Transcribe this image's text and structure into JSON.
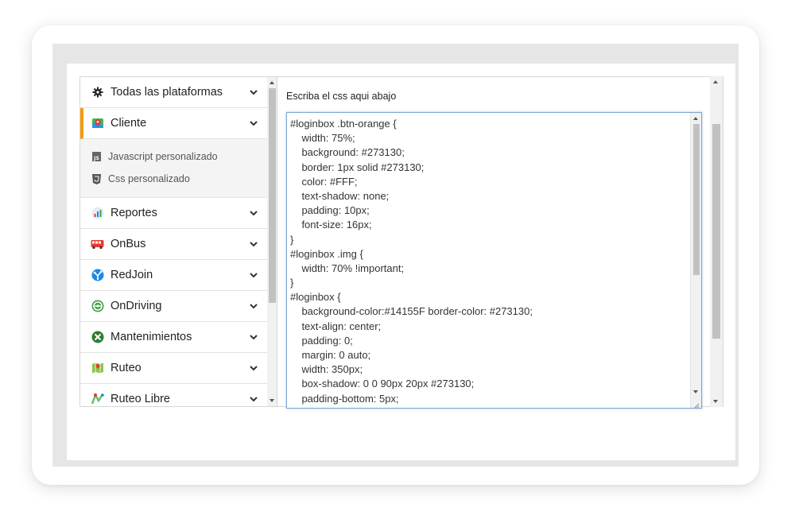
{
  "sidebar": {
    "items": [
      {
        "label": "Todas las plataformas",
        "icon": "gear-icon"
      },
      {
        "label": "Cliente",
        "icon": "map-pin-icon",
        "active": true
      },
      {
        "label": "Reportes",
        "icon": "bar-chart-icon"
      },
      {
        "label": "OnBus",
        "icon": "bus-icon"
      },
      {
        "label": "RedJoin",
        "icon": "network-icon"
      },
      {
        "label": "OnDriving",
        "icon": "steering-wheel-icon"
      },
      {
        "label": "Mantenimientos",
        "icon": "wrench-icon"
      },
      {
        "label": "Ruteo",
        "icon": "map-icon"
      },
      {
        "label": "Ruteo Libre",
        "icon": "route-icon"
      }
    ],
    "submenu": [
      {
        "label": "Javascript personalizado",
        "icon": "js-file-icon"
      },
      {
        "label": "Css personalizado",
        "icon": "css3-icon"
      }
    ]
  },
  "main": {
    "label": "Escriba el css aqui abajo",
    "code_lines": [
      "#loginbox .btn-orange {",
      "    width: 75%;",
      "    background: #273130;",
      "    border: 1px solid #273130;",
      "    color: #FFF;",
      "    text-shadow: none;",
      "    padding: 10px;",
      "    font-size: 16px;",
      "}",
      "#loginbox .img {",
      "    width: 70% !important;",
      "}",
      "#loginbox {",
      "    background-color:#14155F border-color: #273130;",
      "    text-align: center;",
      "    padding: 0;",
      "    margin: 0 auto;",
      "    width: 350px;",
      "    box-shadow: 0 0 90px 20px #273130;",
      "    padding-bottom: 5px;"
    ]
  },
  "colors": {
    "active_accent": "#f39c12",
    "editor_border": "#7fa6cf"
  }
}
